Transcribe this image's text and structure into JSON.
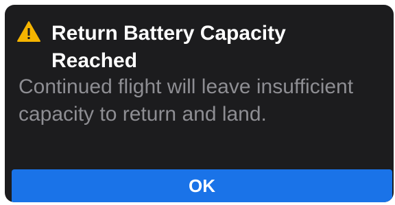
{
  "dialog": {
    "icon": "warning-triangle-icon",
    "title": "Return Battery Capacity Reached",
    "message": "Continued flight will leave insufficient capacity to return and land.",
    "ok_label": "OK"
  },
  "colors": {
    "background": "#1c1c1e",
    "title": "#ffffff",
    "message": "#8e8e93",
    "warning": "#f5b400",
    "button": "#1a73e8"
  }
}
